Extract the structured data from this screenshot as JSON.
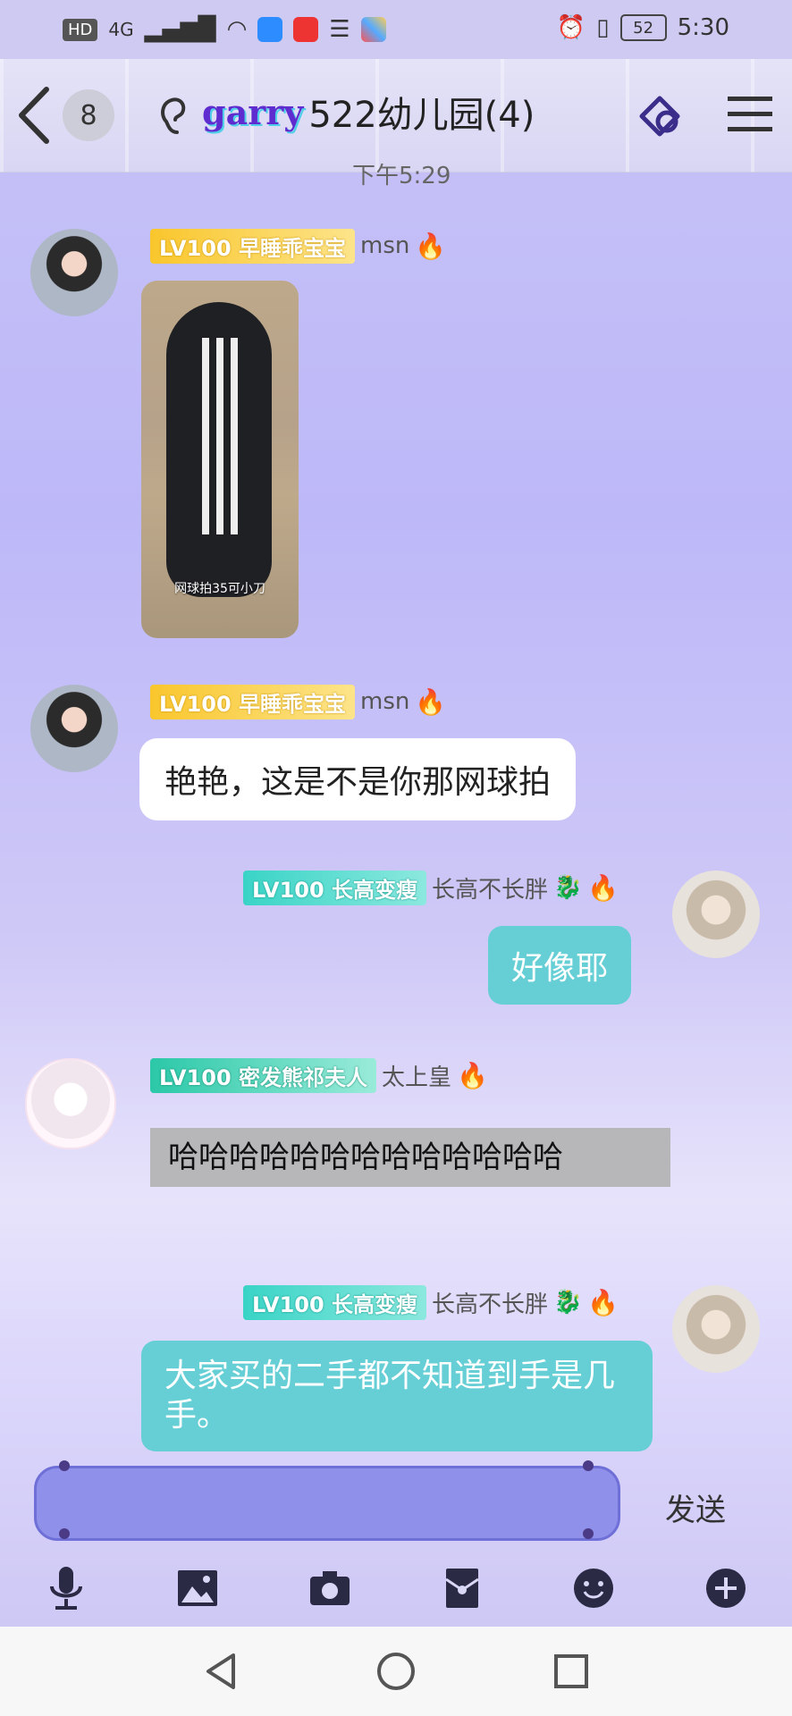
{
  "status_bar": {
    "left_labels": [
      "HD",
      "4G"
    ],
    "time": "5:30",
    "battery": "52"
  },
  "header": {
    "unread_count": "8",
    "logo_text": "garry",
    "title": "522幼儿园(4)",
    "time_peek": "下午5:29"
  },
  "messages": [
    {
      "level": "LV100",
      "title_tag": "早睡乖宝宝",
      "nickname": "msn",
      "image_caption": "网球拍35可小刀"
    },
    {
      "level": "LV100",
      "title_tag": "早睡乖宝宝",
      "nickname": "msn",
      "text": "艳艳，这是不是你那网球拍"
    },
    {
      "level": "LV100",
      "title_tag": "长高变瘦",
      "nickname": "长高不长胖",
      "text": "好像耶"
    },
    {
      "level": "LV100",
      "title_tag": "密发熊祁夫人",
      "nickname": "太上皇",
      "text": "哈哈哈哈哈哈哈哈哈哈哈哈哈"
    },
    {
      "level": "LV100",
      "title_tag": "长高变瘦",
      "nickname": "长高不长胖",
      "text": "大家买的二手都不知道到手是几手。"
    }
  ],
  "input": {
    "value": "",
    "send_label": "发送"
  },
  "toolbar": {
    "icons": [
      "mic-icon",
      "image-icon",
      "camera-icon",
      "redpacket-icon",
      "emoji-icon",
      "plus-icon"
    ]
  },
  "colors": {
    "input_bg": "#8f90ea",
    "teal_bubble": "#66cfd6",
    "lv_gold": "#f9c62c",
    "lv_teal": "#39d4c6"
  }
}
